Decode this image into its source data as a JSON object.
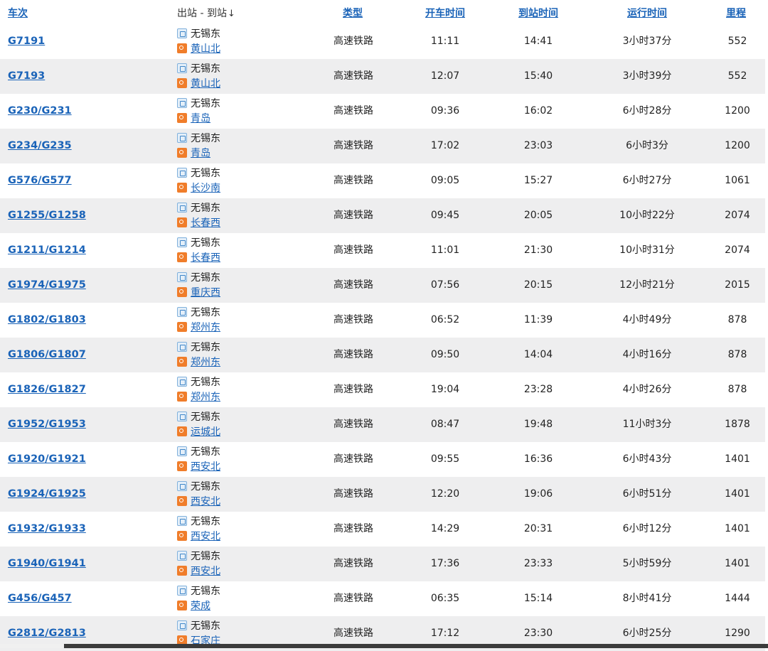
{
  "header": {
    "train_no": "车次",
    "stations": "出站 - 到站",
    "stations_sort": "↓",
    "type": "类型",
    "departure": "开车时间",
    "arrival": "到站时间",
    "duration": "运行时间",
    "distance": "里程"
  },
  "rows": [
    {
      "train": "G7191",
      "from": "无锡东",
      "to": "黄山北",
      "type": "高速铁路",
      "dep": "11:11",
      "arr": "14:41",
      "dur": "3小时37分",
      "dist": "552"
    },
    {
      "train": "G7193",
      "from": "无锡东",
      "to": "黄山北",
      "type": "高速铁路",
      "dep": "12:07",
      "arr": "15:40",
      "dur": "3小时39分",
      "dist": "552"
    },
    {
      "train": "G230/G231",
      "from": "无锡东",
      "to": "青岛",
      "type": "高速铁路",
      "dep": "09:36",
      "arr": "16:02",
      "dur": "6小时28分",
      "dist": "1200"
    },
    {
      "train": "G234/G235",
      "from": "无锡东",
      "to": "青岛",
      "type": "高速铁路",
      "dep": "17:02",
      "arr": "23:03",
      "dur": "6小时3分",
      "dist": "1200"
    },
    {
      "train": "G576/G577",
      "from": "无锡东",
      "to": "长沙南",
      "type": "高速铁路",
      "dep": "09:05",
      "arr": "15:27",
      "dur": "6小时27分",
      "dist": "1061"
    },
    {
      "train": "G1255/G1258",
      "from": "无锡东",
      "to": "长春西",
      "type": "高速铁路",
      "dep": "09:45",
      "arr": "20:05",
      "dur": "10小时22分",
      "dist": "2074"
    },
    {
      "train": "G1211/G1214",
      "from": "无锡东",
      "to": "长春西",
      "type": "高速铁路",
      "dep": "11:01",
      "arr": "21:30",
      "dur": "10小时31分",
      "dist": "2074"
    },
    {
      "train": "G1974/G1975",
      "from": "无锡东",
      "to": "重庆西",
      "type": "高速铁路",
      "dep": "07:56",
      "arr": "20:15",
      "dur": "12小时21分",
      "dist": "2015"
    },
    {
      "train": "G1802/G1803",
      "from": "无锡东",
      "to": "郑州东",
      "type": "高速铁路",
      "dep": "06:52",
      "arr": "11:39",
      "dur": "4小时49分",
      "dist": "878"
    },
    {
      "train": "G1806/G1807",
      "from": "无锡东",
      "to": "郑州东",
      "type": "高速铁路",
      "dep": "09:50",
      "arr": "14:04",
      "dur": "4小时16分",
      "dist": "878"
    },
    {
      "train": "G1826/G1827",
      "from": "无锡东",
      "to": "郑州东",
      "type": "高速铁路",
      "dep": "19:04",
      "arr": "23:28",
      "dur": "4小时26分",
      "dist": "878"
    },
    {
      "train": "G1952/G1953",
      "from": "无锡东",
      "to": "运城北",
      "type": "高速铁路",
      "dep": "08:47",
      "arr": "19:48",
      "dur": "11小时3分",
      "dist": "1878"
    },
    {
      "train": "G1920/G1921",
      "from": "无锡东",
      "to": "西安北",
      "type": "高速铁路",
      "dep": "09:55",
      "arr": "16:36",
      "dur": "6小时43分",
      "dist": "1401"
    },
    {
      "train": "G1924/G1925",
      "from": "无锡东",
      "to": "西安北",
      "type": "高速铁路",
      "dep": "12:20",
      "arr": "19:06",
      "dur": "6小时51分",
      "dist": "1401"
    },
    {
      "train": "G1932/G1933",
      "from": "无锡东",
      "to": "西安北",
      "type": "高速铁路",
      "dep": "14:29",
      "arr": "20:31",
      "dur": "6小时12分",
      "dist": "1401"
    },
    {
      "train": "G1940/G1941",
      "from": "无锡东",
      "to": "西安北",
      "type": "高速铁路",
      "dep": "17:36",
      "arr": "23:33",
      "dur": "5小时59分",
      "dist": "1401"
    },
    {
      "train": "G456/G457",
      "from": "无锡东",
      "to": "荣成",
      "type": "高速铁路",
      "dep": "06:35",
      "arr": "15:14",
      "dur": "8小时41分",
      "dist": "1444"
    },
    {
      "train": "G2812/G2813",
      "from": "无锡东",
      "to": "石家庄",
      "type": "高速铁路",
      "dep": "17:12",
      "arr": "23:30",
      "dur": "6小时25分",
      "dist": "1290"
    }
  ],
  "icons": {
    "pass_station": "pass-station-icon",
    "terminal_station": "terminal-station-icon"
  },
  "colors": {
    "link": "#1a63b8",
    "row_alt": "#eeeeef",
    "terminal_badge": "#f07d2a",
    "pass_badge": "#7fb0dc"
  }
}
